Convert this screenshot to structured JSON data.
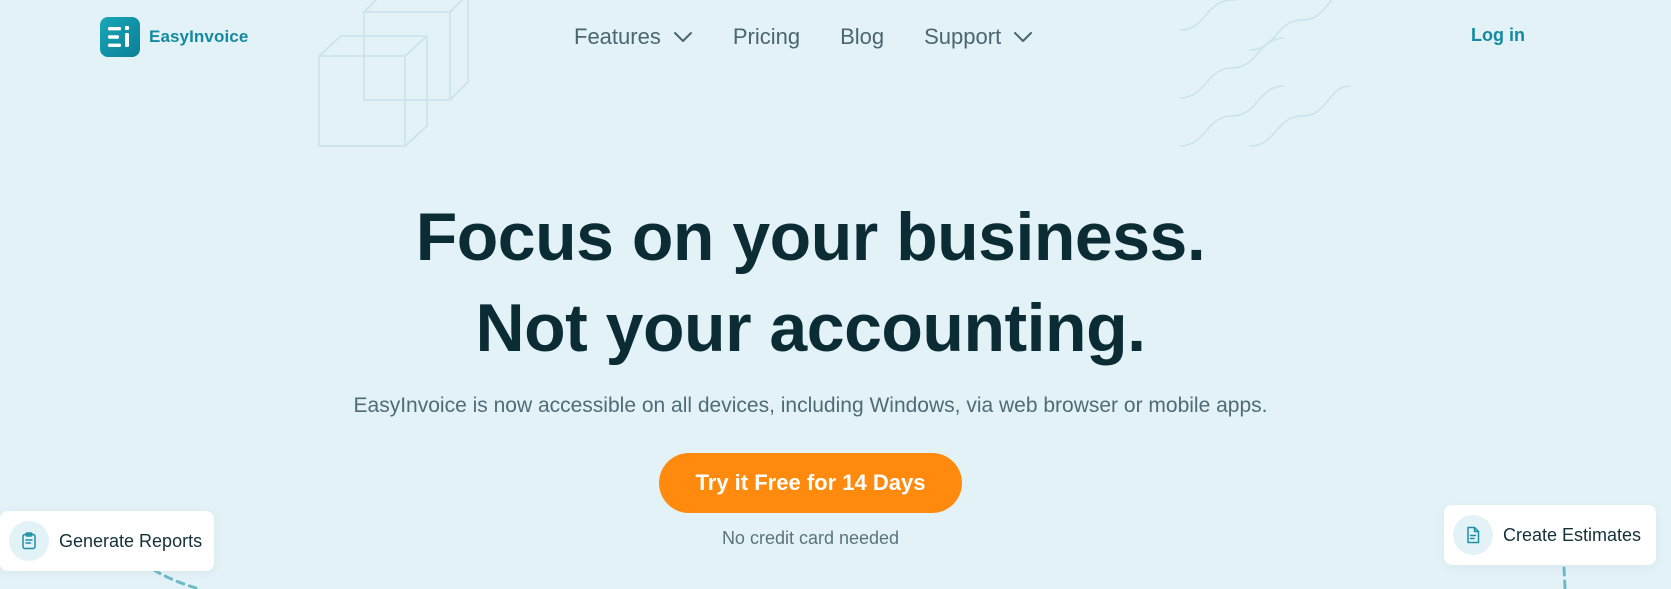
{
  "header": {
    "logo_text": "EasyInvoice",
    "nav": [
      {
        "label": "Features",
        "has_dropdown": true
      },
      {
        "label": "Pricing",
        "has_dropdown": false
      },
      {
        "label": "Blog",
        "has_dropdown": false
      },
      {
        "label": "Support",
        "has_dropdown": true
      }
    ],
    "login_label": "Log in"
  },
  "hero": {
    "title_line1": "Focus on your business.",
    "title_line2": "Not your accounting.",
    "subtitle": "EasyInvoice is now accessible on all devices, including Windows, via web browser or mobile apps.",
    "cta_label": "Try it Free for 14 Days",
    "note": "No credit card needed"
  },
  "feature_cards": [
    {
      "label": "Generate Reports",
      "icon": "clipboard-icon"
    },
    {
      "label": "Create Estimates",
      "icon": "document-icon"
    }
  ],
  "colors": {
    "background": "#e3f2f7",
    "brand_teal": "#138aa2",
    "cta_orange": "#ff8a0d",
    "heading": "#0b2c35",
    "body_text": "#4f6c76"
  }
}
